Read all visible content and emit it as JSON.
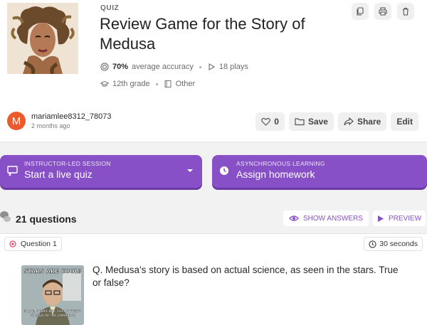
{
  "quiz": {
    "type_label": "QUIZ",
    "title": "Review Game for the Story of Medusa",
    "accuracy": "70%",
    "accuracy_label": "average accuracy",
    "plays": "18 plays",
    "grade": "12th grade",
    "subject": "Other"
  },
  "top_actions": {
    "icons": [
      "copy-icon",
      "print-icon",
      "trash-icon"
    ]
  },
  "author": {
    "initial": "M",
    "name": "mariamlee8312_78073",
    "time": "2 months ago",
    "avatar_color": "#ec5a2c"
  },
  "social": {
    "likes": "0",
    "save": "Save",
    "share": "Share",
    "edit": "Edit"
  },
  "sessions": {
    "live": {
      "small": "INSTRUCTOR-LED SESSION",
      "big": "Start a live quiz"
    },
    "homework": {
      "small": "ASYNCHRONOUS LEARNING",
      "big": "Assign homework"
    },
    "color": "#8850c7"
  },
  "questions": {
    "count": "21 questions",
    "show_answers": "SHOW ANSWERS",
    "preview": "PREVIEW"
  },
  "question1": {
    "label": "Question 1",
    "time": "30 seconds",
    "text": "Q. Medusa's story is based on actual science, as seen in the stars. True or false?",
    "meme_top": "STARS ARE COOL?",
    "meme_bottom": "FALSE. STARS ARE THE HOTTEST THINGS IN THE UNIVERSE"
  }
}
